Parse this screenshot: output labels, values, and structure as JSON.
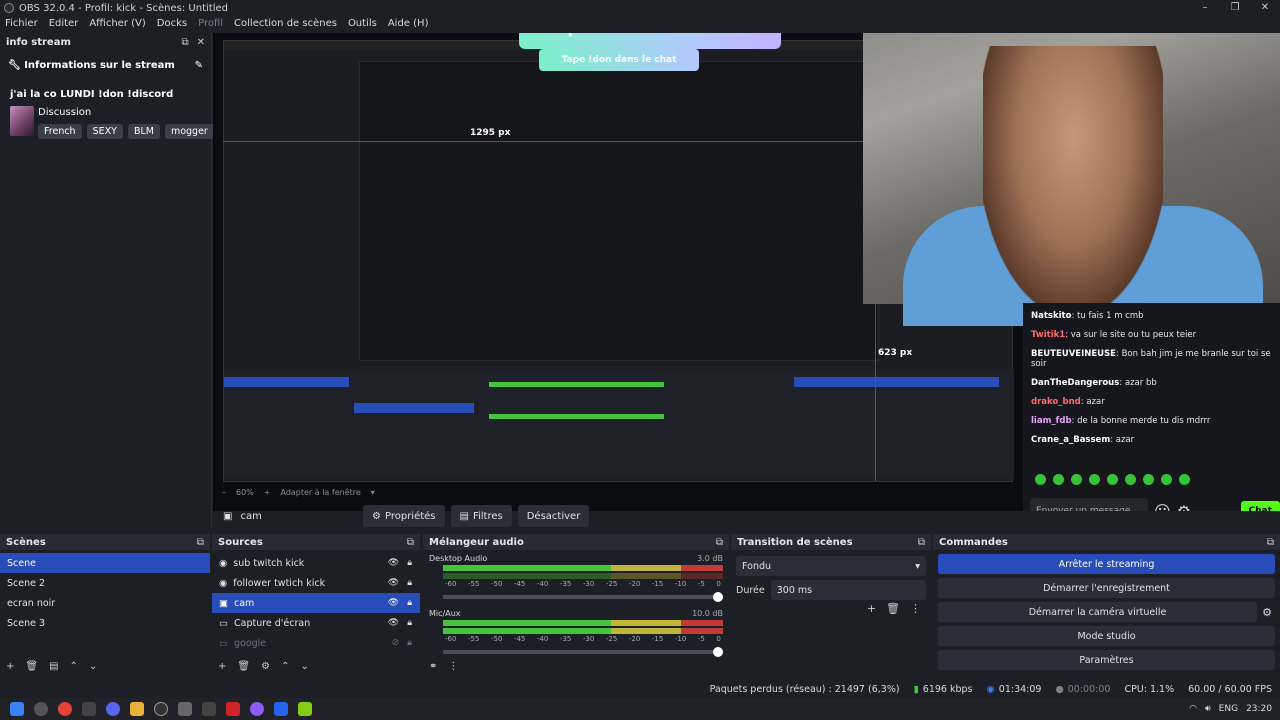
{
  "window": {
    "title": "OBS 32.0.4 - Profil: kick - Scènes: Untitled",
    "controls": [
      "–",
      "❐",
      "✕"
    ]
  },
  "menu": [
    "Fichier",
    "Editer",
    "Afficher (V)",
    "Docks",
    "Profil",
    "Collection de scènes",
    "Outils",
    "Aide (H)"
  ],
  "info_dock": {
    "title": "info stream",
    "header": "Informations sur le stream",
    "stream_title": "j'ai la co LUNDI !don !discord",
    "category": "Discussion",
    "tags": [
      "French",
      "SEXY",
      "BLM",
      "mogger"
    ]
  },
  "preview": {
    "banner": "Tape !don dans le chat",
    "banner_small": "Tape !don dans le chat",
    "measure_1": "1295 px",
    "measure_2": "623 px",
    "chat": [
      {
        "user": "Natskito",
        "msg": ": tu fais 1 m cmb"
      },
      {
        "user": "Twitik1",
        "msg": ": va sur le site ou tu peux teier"
      },
      {
        "user": "BEUTEUVEINEUSE",
        "msg": ": Bon bah jim je me branle sur toi se soir"
      },
      {
        "user": "DanTheDangerous",
        "msg": ": azar bb"
      },
      {
        "user": "drako_bnd",
        "msg": ": azar"
      },
      {
        "user": "liam_fdb",
        "msg": ": de la bonne merde tu dis mdrrr"
      },
      {
        "user": "Crane_a_Bassem",
        "msg": ": azar"
      }
    ],
    "chat_input_placeholder": "Envoyer un message",
    "chat_button": "Chat",
    "zoom": "60%",
    "fit": "Adapter à la fenêtre"
  },
  "context": {
    "source": "cam",
    "properties": "Propriétés",
    "filters": "Filtres",
    "disable": "Désactiver"
  },
  "scenes": {
    "title": "Scènes",
    "items": [
      "Scene",
      "Scene 2",
      "ecran noir",
      "Scene 3"
    ]
  },
  "sources": {
    "title": "Sources",
    "items": [
      "sub twitch kick",
      "follower twtich kick",
      "cam",
      "Capture d'écran",
      "google"
    ]
  },
  "mixer": {
    "title": "Mélangeur audio",
    "channels": [
      {
        "name": "Desktop Audio",
        "db": "3.0 dB"
      },
      {
        "name": "Mic/Aux",
        "db": "10.0 dB"
      }
    ],
    "scale": [
      "-60",
      "-55",
      "-50",
      "-45",
      "-40",
      "-35",
      "-30",
      "-25",
      "-20",
      "-15",
      "-10",
      "-5",
      "0"
    ]
  },
  "transition": {
    "title": "Transition de scènes",
    "type": "Fondu",
    "duration_label": "Durée",
    "duration": "300 ms"
  },
  "commands": {
    "title": "Commandes",
    "buttons": [
      "Arrêter le streaming",
      "Démarrer l'enregistrement",
      "Démarrer la caméra virtuelle",
      "Mode studio",
      "Paramètres"
    ]
  },
  "status": {
    "dropped": "Paquets perdus (réseau) : 21497 (6,3%)",
    "bitrate": "6196 kbps",
    "stream_time": "01:34:09",
    "rec_time": "00:00:00",
    "cpu": "CPU: 1.1%",
    "fps": "60.00 / 60.00 FPS"
  },
  "taskbar": {
    "lang": "ENG",
    "time": "23:20"
  },
  "colors": {
    "accent": "#284cb8",
    "kick_green": "#53fc18",
    "bg": "#1d1f26"
  }
}
